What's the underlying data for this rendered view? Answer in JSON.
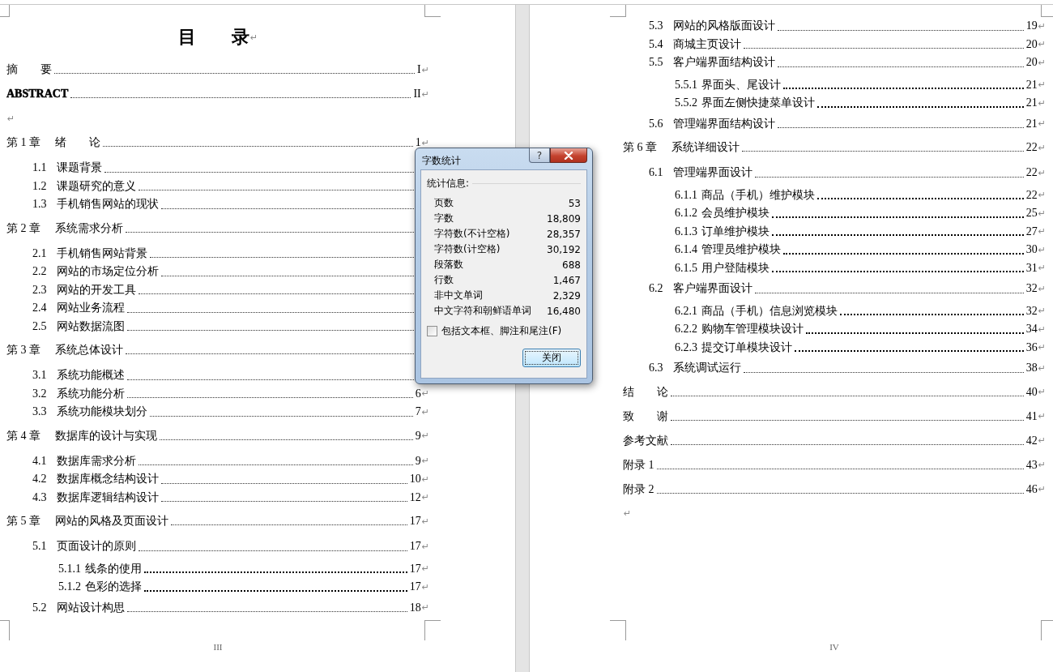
{
  "pages": [
    {
      "title": "目　　录",
      "title_mark": "↵",
      "footer": "III",
      "entries": [
        {
          "title": "摘　　要",
          "bold": false,
          "page": "I",
          "mark": "↵"
        },
        {
          "title": "ABSTRACT",
          "bold": true,
          "page": "II",
          "mark": "↵"
        },
        {
          "mark": "↵"
        },
        {
          "num": "第 1 章",
          "title": "绪　　论",
          "bold": false,
          "page": "1",
          "mark": "↵",
          "children": [
            {
              "num": "1.1",
              "title": "课题背景"
            },
            {
              "num": "1.2",
              "title": "课题研究的意义"
            },
            {
              "num": "1.3",
              "title": "手机销售网站的现状"
            }
          ]
        },
        {
          "num": "第 2 章",
          "title": "系统需求分析",
          "bold": false,
          "children": [
            {
              "num": "2.1",
              "title": "手机销售网站背景"
            },
            {
              "num": "2.2",
              "title": "网站的市场定位分析"
            },
            {
              "num": "2.3",
              "title": "网站的开发工具"
            },
            {
              "num": "2.4",
              "title": "网站业务流程"
            },
            {
              "num": "2.5",
              "title": "网站数据流图"
            }
          ]
        },
        {
          "num": "第 3 章",
          "title": "系统总体设计",
          "bold": false,
          "children": [
            {
              "num": "3.1",
              "title": "系统功能概述"
            },
            {
              "num": "3.2",
              "title": "系统功能分析",
              "page": "6",
              "mark": "↵"
            },
            {
              "num": "3.3",
              "title": "系统功能模块划分",
              "page": "7",
              "mark": "↵"
            }
          ]
        },
        {
          "num": "第 4 章",
          "title": "数据库的设计与实现",
          "bold": false,
          "page": "9",
          "mark": "↵",
          "children": [
            {
              "num": "4.1",
              "title": "数据库需求分析",
              "page": "9",
              "mark": "↵"
            },
            {
              "num": "4.2",
              "title": "数据库概念结构设计",
              "page": "10",
              "mark": "↵"
            },
            {
              "num": "4.3",
              "title": "数据库逻辑结构设计",
              "page": "12",
              "mark": "↵"
            }
          ]
        },
        {
          "num": "第 5 章",
          "title": "网站的风格及页面设计",
          "bold": false,
          "page": "17",
          "mark": "↵",
          "children": [
            {
              "num": "5.1",
              "title": "页面设计的原则",
              "page": "17",
              "mark": "↵",
              "children": [
                {
                  "num": "5.1.1",
                  "title": "线条的使用",
                  "page": "17",
                  "mark": "↵"
                },
                {
                  "num": "5.1.2",
                  "title": "色彩的选择",
                  "page": "17",
                  "mark": "↵"
                }
              ]
            },
            {
              "num": "5.2",
              "title": "网站设计构思",
              "page": "18",
              "mark": "↵"
            }
          ]
        }
      ]
    },
    {
      "footer": "IV",
      "entries": [
        {
          "children": [
            {
              "num": "5.3",
              "title": "网站的风格版面设计",
              "page": "19",
              "mark": "↵"
            },
            {
              "num": "5.4",
              "title": "商城主页设计",
              "page": "20",
              "mark": "↵"
            },
            {
              "num": "5.5",
              "title": "客户端界面结构设计",
              "page": "20",
              "mark": "↵",
              "children": [
                {
                  "num": "5.5.1",
                  "title": "界面头、尾设计",
                  "page": "21",
                  "mark": "↵"
                },
                {
                  "num": "5.5.2",
                  "title": "界面左侧快捷菜单设计",
                  "page": "21",
                  "mark": "↵"
                }
              ]
            },
            {
              "num": "5.6",
              "title": "管理端界面结构设计",
              "page": "21",
              "mark": "↵"
            }
          ]
        },
        {
          "num": "第 6 章",
          "title": "系统详细设计",
          "bold": false,
          "page": "22",
          "mark": "↵",
          "children": [
            {
              "num": "6.1",
              "title": "管理端界面设计",
              "page": "22",
              "mark": "↵",
              "children": [
                {
                  "num": "6.1.1",
                  "title": "商品（手机）维护模块",
                  "page": "22",
                  "mark": "↵"
                },
                {
                  "num": "6.1.2",
                  "title": "会员维护模块",
                  "page": "25",
                  "mark": "↵"
                },
                {
                  "num": "6.1.3",
                  "title": "订单维护模块",
                  "page": "27",
                  "mark": "↵"
                },
                {
                  "num": "6.1.4",
                  "title": "管理员维护模块",
                  "page": "30",
                  "mark": "↵"
                },
                {
                  "num": "6.1.5",
                  "title": "用户登陆模块",
                  "page": "31",
                  "mark": "↵"
                }
              ]
            },
            {
              "num": "6.2",
              "title": "客户端界面设计",
              "page": "32",
              "mark": "↵",
              "children": [
                {
                  "num": "6.2.1",
                  "title": "商品（手机）信息浏览模块",
                  "page": "32",
                  "mark": "↵"
                },
                {
                  "num": "6.2.2",
                  "title": "购物车管理模块设计",
                  "page": "34",
                  "mark": "↵"
                },
                {
                  "num": "6.2.3",
                  "title": "提交订单模块设计",
                  "page": "36",
                  "mark": "↵"
                }
              ]
            },
            {
              "num": "6.3",
              "title": "系统调试运行",
              "page": "38",
              "mark": "↵"
            }
          ]
        },
        {
          "title": "结　　论",
          "bold": false,
          "page": "40",
          "mark": "↵"
        },
        {
          "title": "致　　谢",
          "bold": false,
          "page": "41",
          "mark": "↵"
        },
        {
          "title": "参考文献",
          "bold": false,
          "page": "42",
          "mark": "↵"
        },
        {
          "title": "附录 1",
          "bold": false,
          "page": "43",
          "mark": "↵"
        },
        {
          "title": "附录 2",
          "bold": false,
          "page": "46",
          "mark": "↵"
        },
        {
          "mark": "↵"
        }
      ]
    }
  ],
  "dialog": {
    "title": "字数统计",
    "help": "?",
    "group": "统计信息:",
    "stats": [
      {
        "label": "页数",
        "value": "53"
      },
      {
        "label": "字数",
        "value": "18,809"
      },
      {
        "label": "字符数(不计空格)",
        "value": "28,357"
      },
      {
        "label": "字符数(计空格)",
        "value": "30,192"
      },
      {
        "label": "段落数",
        "value": "688"
      },
      {
        "label": "行数",
        "value": "1,467"
      },
      {
        "label": "非中文单词",
        "value": "2,329"
      },
      {
        "label": "中文字符和朝鲜语单词",
        "value": "16,480"
      }
    ],
    "checkbox": {
      "label": "包括文本框、脚注和尾注(F)",
      "checked": false
    },
    "button": "关闭"
  }
}
